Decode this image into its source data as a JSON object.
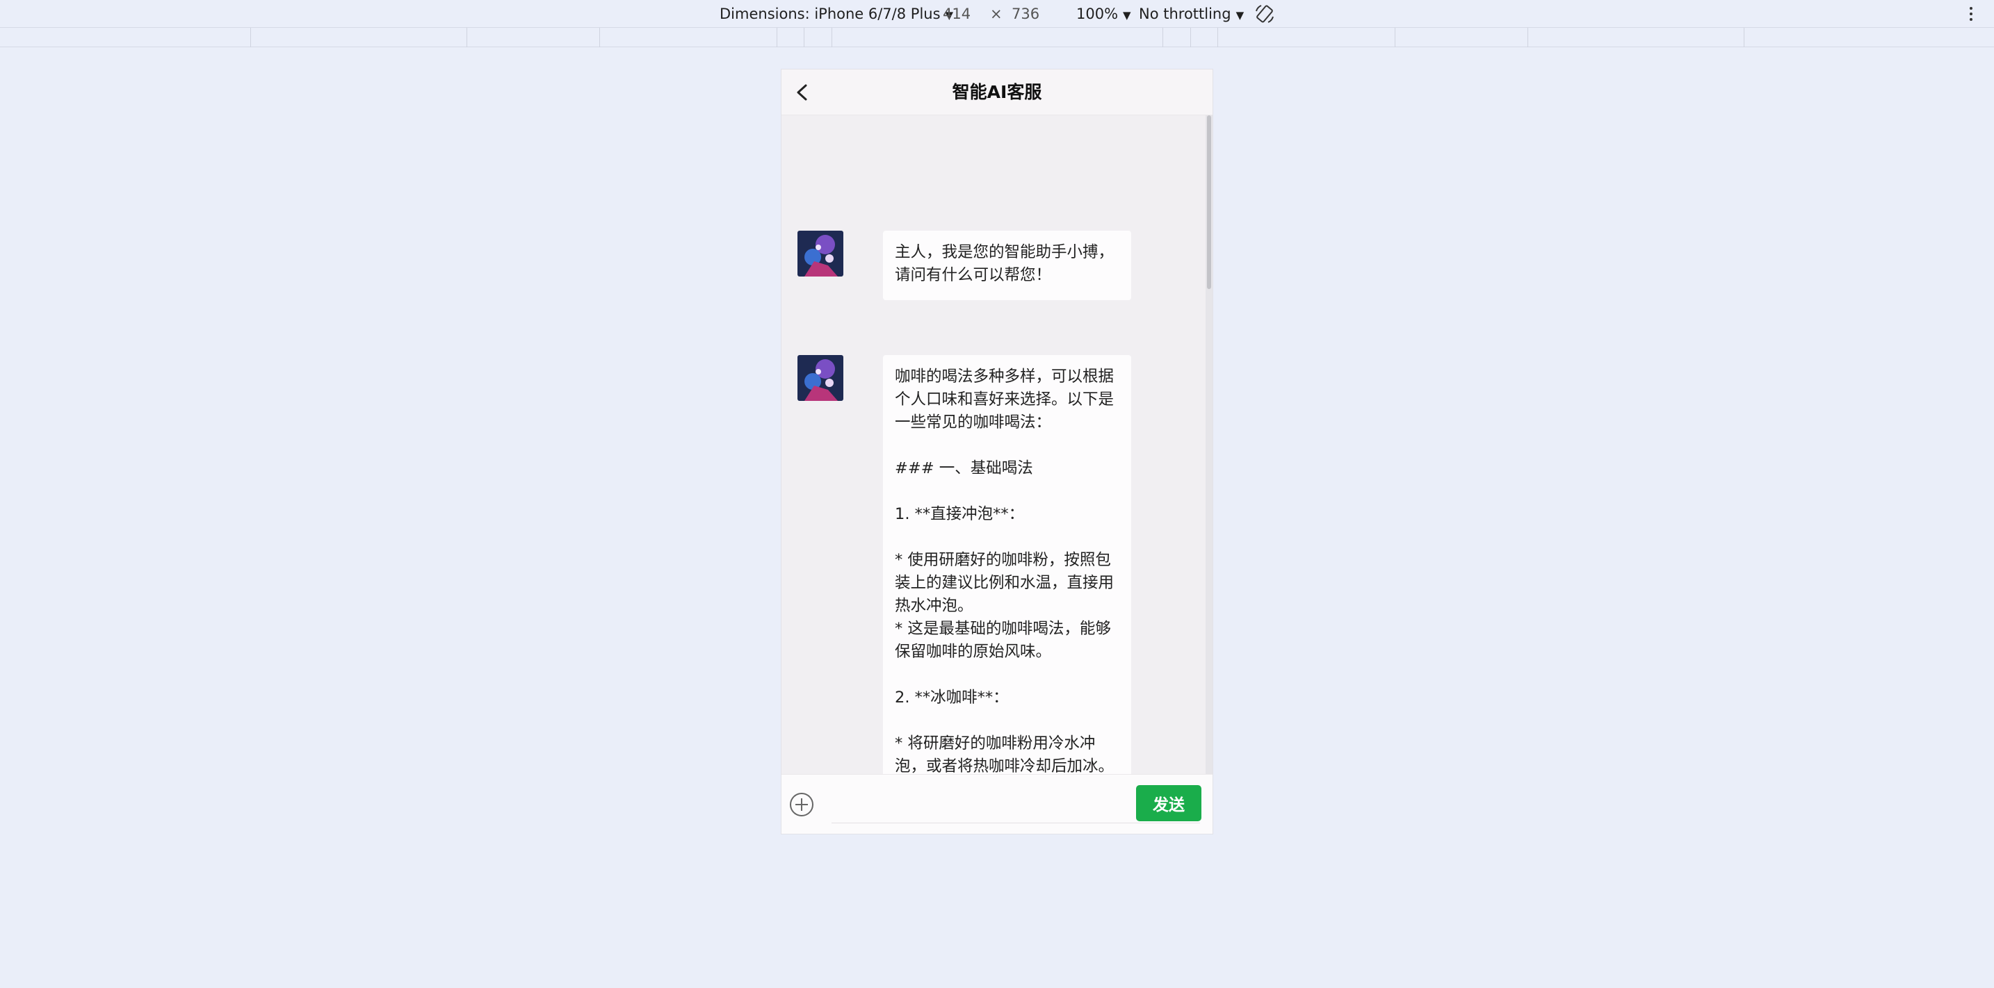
{
  "devtools": {
    "dimensions_label": "Dimensions: iPhone 6/7/8 Plus",
    "width": "414",
    "times": "×",
    "height": "736",
    "zoom": "100%",
    "throttling": "No throttling",
    "caret": "▼",
    "rotate_icon": "rotate-icon",
    "more_icon": "more-vertical-icon"
  },
  "header": {
    "title": "智能AI客服",
    "back_icon": "chevron-left-icon"
  },
  "messages": [
    {
      "sender": "assistant",
      "text": "主人，我是您的智能助手小搏，请问有什么可以帮您！"
    },
    {
      "sender": "assistant",
      "text": "咖啡的喝法多种多样，可以根据个人口味和喜好来选择。以下是一些常见的咖啡喝法：\n\n### 一、基础喝法\n\n1. **直接冲泡**：\n\n* 使用研磨好的咖啡粉，按照包装上的建议比例和水温，直接用热水冲泡。\n* 这是最基础的咖啡喝法，能够保留咖啡的原始风味。\n\n2. **冰咖啡**：\n\n* 将研磨好的咖啡粉用冷水冲泡，或者将热咖啡冷却后加冰。\n* 冰咖啡口感清爽，适合夏天饮用。"
    }
  ],
  "input_bar": {
    "plus_icon": "plus-circle-icon",
    "input_value": "",
    "send_label": "发送"
  },
  "colors": {
    "page_background": "#eaeef9",
    "chat_background": "#f1eff2",
    "bubble": "#fdfcfd",
    "send_button": "#1aad4b"
  }
}
